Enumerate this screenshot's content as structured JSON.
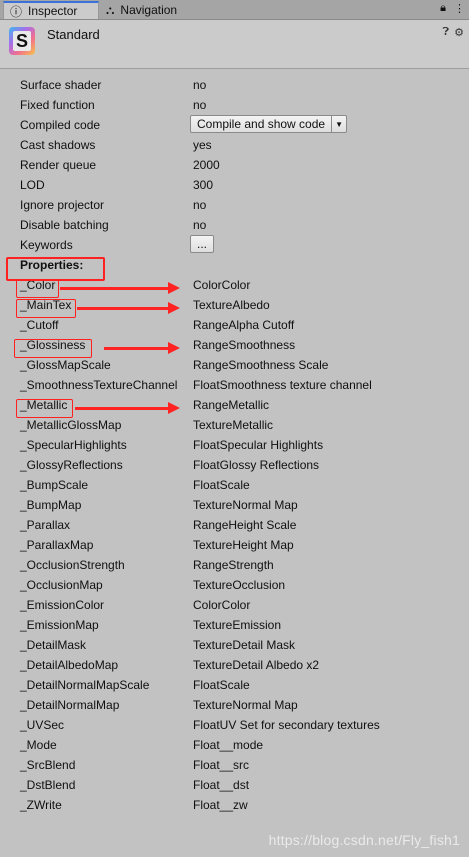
{
  "tabs": [
    {
      "label": "Inspector",
      "icon": "info-icon"
    },
    {
      "label": "Navigation",
      "icon": "navigation-icon"
    }
  ],
  "header": {
    "title": "Standard",
    "icon_letter": "S"
  },
  "info": [
    {
      "key": "Surface shader",
      "value": "no"
    },
    {
      "key": "Fixed function",
      "value": "no"
    },
    {
      "key": "Compiled code",
      "button": "Compile and show code"
    },
    {
      "key": "Cast shadows",
      "value": "yes"
    },
    {
      "key": "Render queue",
      "value": "2000"
    },
    {
      "key": "LOD",
      "value": "300"
    },
    {
      "key": "Ignore projector",
      "value": "no"
    },
    {
      "key": "Disable batching",
      "value": "no"
    },
    {
      "key": "Keywords",
      "button": "..."
    }
  ],
  "properties_label": "Properties:",
  "properties": [
    {
      "key": "_Color",
      "value": "ColorColor"
    },
    {
      "key": "_MainTex",
      "value": "TextureAlbedo"
    },
    {
      "key": "_Cutoff",
      "value": "RangeAlpha Cutoff"
    },
    {
      "key": "_Glossiness",
      "value": "RangeSmoothness"
    },
    {
      "key": "_GlossMapScale",
      "value": "RangeSmoothness Scale"
    },
    {
      "key": "_SmoothnessTextureChannel",
      "value": "FloatSmoothness texture channel"
    },
    {
      "key": "_Metallic",
      "value": "RangeMetallic"
    },
    {
      "key": "_MetallicGlossMap",
      "value": "TextureMetallic"
    },
    {
      "key": "_SpecularHighlights",
      "value": "FloatSpecular Highlights"
    },
    {
      "key": "_GlossyReflections",
      "value": "FloatGlossy Reflections"
    },
    {
      "key": "_BumpScale",
      "value": "FloatScale"
    },
    {
      "key": "_BumpMap",
      "value": "TextureNormal Map"
    },
    {
      "key": "_Parallax",
      "value": "RangeHeight Scale"
    },
    {
      "key": "_ParallaxMap",
      "value": "TextureHeight Map"
    },
    {
      "key": "_OcclusionStrength",
      "value": "RangeStrength"
    },
    {
      "key": "_OcclusionMap",
      "value": "TextureOcclusion"
    },
    {
      "key": "_EmissionColor",
      "value": "ColorColor"
    },
    {
      "key": "_EmissionMap",
      "value": "TextureEmission"
    },
    {
      "key": "_DetailMask",
      "value": "TextureDetail Mask"
    },
    {
      "key": "_DetailAlbedoMap",
      "value": "TextureDetail Albedo x2"
    },
    {
      "key": "_DetailNormalMapScale",
      "value": "FloatScale"
    },
    {
      "key": "_DetailNormalMap",
      "value": "TextureNormal Map"
    },
    {
      "key": "_UVSec",
      "value": "FloatUV Set for secondary textures"
    },
    {
      "key": "_Mode",
      "value": "Float__mode"
    },
    {
      "key": "_SrcBlend",
      "value": "Float__src"
    },
    {
      "key": "_DstBlend",
      "value": "Float__dst"
    },
    {
      "key": "_ZWrite",
      "value": "Float__zw"
    }
  ],
  "watermark": "https://blog.csdn.net/Fly_fish1",
  "colors": {
    "annotation": "#ff2020",
    "active_tab": "#3a72d8"
  }
}
